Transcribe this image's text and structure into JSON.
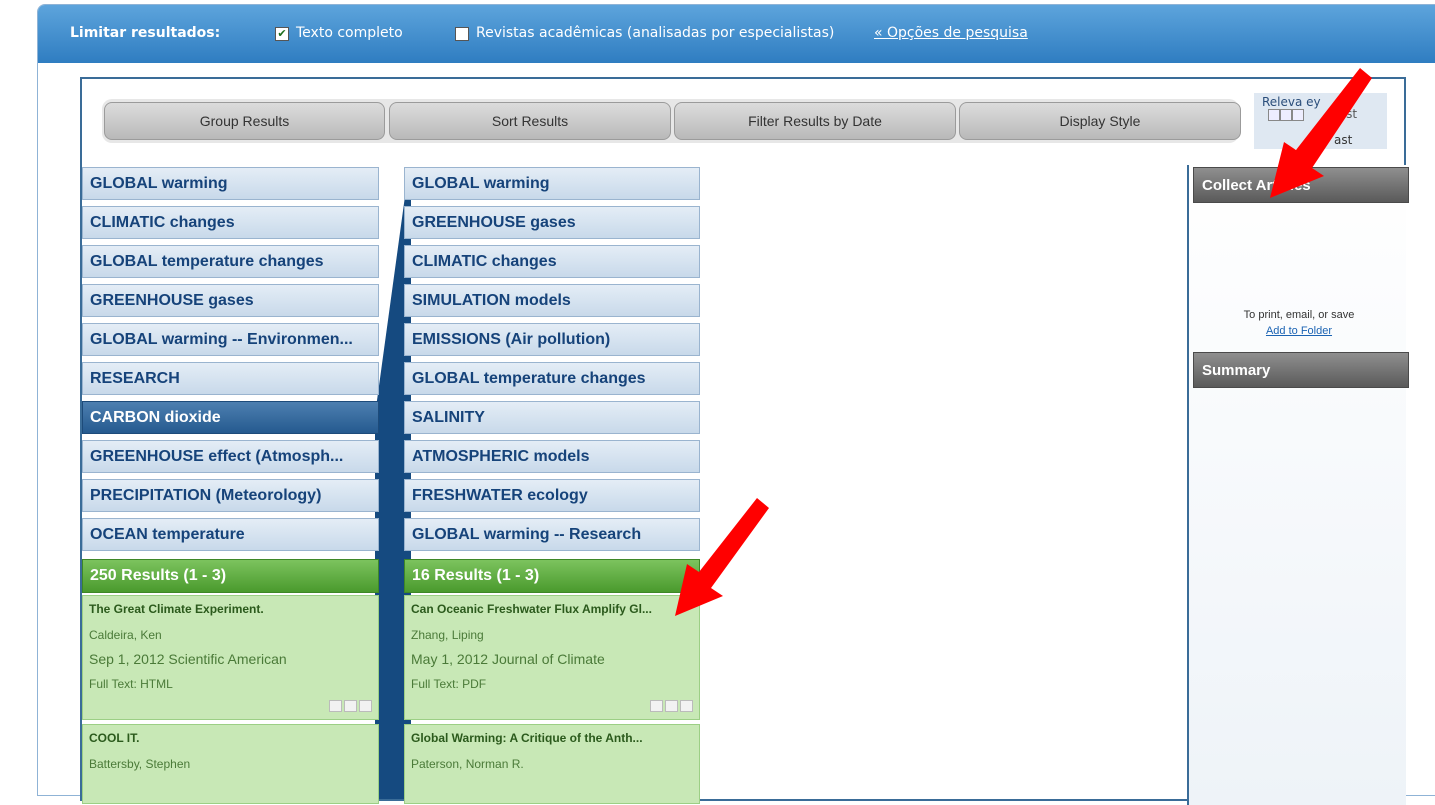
{
  "limit_bar": {
    "label": "Limitar resultados:",
    "full_text_label": "Texto completo",
    "full_text_checked": true,
    "scholarly_label": "Revistas acadêmicas (analisadas por especialistas)",
    "scholarly_checked": false,
    "options_link": "« Opções de pesquisa"
  },
  "toolbar": {
    "buttons": [
      "Group Results",
      "Sort Results",
      "Filter Results by Date",
      "Display Style"
    ]
  },
  "relevance": {
    "line1": "Releva     ey",
    "line2": "test",
    "line3": "ast"
  },
  "column1": {
    "categories": [
      "GLOBAL warming",
      "CLIMATIC changes",
      "GLOBAL temperature changes",
      "GREENHOUSE gases",
      "GLOBAL warming -- Environmen...",
      "RESEARCH",
      "CARBON dioxide",
      "GREENHOUSE effect (Atmosph...",
      "PRECIPITATION (Meteorology)",
      "OCEAN temperature"
    ],
    "selected_index": 6,
    "results_header": "250 Results (1 - 3)",
    "results": [
      {
        "title": "The Great Climate Experiment.",
        "author": "Caldeira, Ken",
        "date_source": "Sep 1, 2012 Scientific American",
        "fulltext": "Full Text: HTML"
      },
      {
        "title": "COOL IT.",
        "author": "Battersby, Stephen"
      }
    ]
  },
  "column2": {
    "categories": [
      "GLOBAL warming",
      "GREENHOUSE gases",
      "CLIMATIC changes",
      "SIMULATION models",
      "EMISSIONS (Air pollution)",
      "GLOBAL temperature changes",
      "SALINITY",
      "ATMOSPHERIC models",
      "FRESHWATER ecology",
      "GLOBAL warming -- Research"
    ],
    "results_header": "16 Results (1 - 3)",
    "results": [
      {
        "title": "Can Oceanic Freshwater Flux Amplify Gl...",
        "author": "Zhang, Liping",
        "date_source": "May 1, 2012 Journal of Climate",
        "fulltext": "Full Text: PDF"
      },
      {
        "title": "Global Warming: A Critique of the Anth...",
        "author": "Paterson, Norman R."
      }
    ]
  },
  "right_panel": {
    "collect_title": "Collect Articles",
    "collect_text": "To print, email, or save",
    "collect_link": "Add to Folder",
    "summary_title": "Summary"
  },
  "colors": {
    "accent_blue": "#2f7dc1",
    "category_text": "#16437a",
    "results_green": "#4a9a2d",
    "annotation_arrow": "#ff0000"
  }
}
